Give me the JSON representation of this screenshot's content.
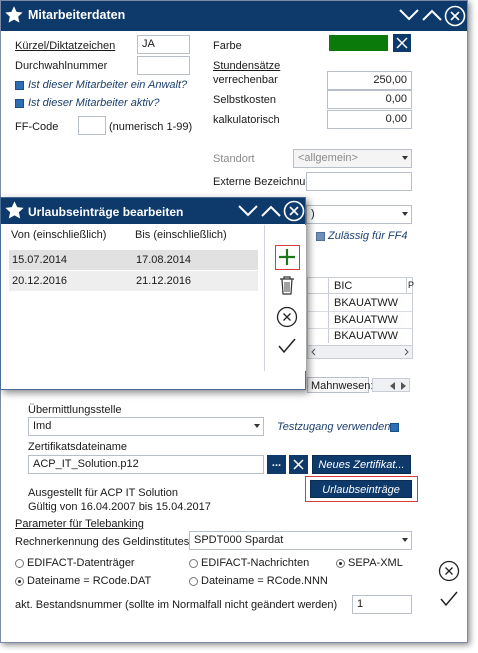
{
  "main": {
    "title": "Mitarbeiterdaten",
    "kuerzel_label": "Kürzel/Diktatzeichen",
    "kuerzel_value": "JA",
    "durchwahl_label": "Durchwahlnummer",
    "anwalt_label": "Ist dieser Mitarbeiter ein Anwalt?",
    "aktiv_label": "Ist dieser Mitarbeiter aktiv?",
    "ffcode_label": "FF-Code",
    "ffcode_hint": "(numerisch 1-99)",
    "farbe_label": "Farbe",
    "farbe_color": "#0a7a0a",
    "stundensaetze_label": "Stundensätze",
    "verrechenbar_label": "verrechenbar",
    "verrechenbar_value": "250,00",
    "selbstkosten_label": "Selbstkosten",
    "selbstkosten_value": "0,00",
    "kalkulatorisch_label": "kalkulatorisch",
    "kalkulatorisch_value": "0,00",
    "standort_label": "Standort",
    "standort_value": "<allgemein>",
    "externe_label": "Externe Bezeichnun",
    "zulaessig_label": "Zulässig für FF4",
    "grid_header": "BIC",
    "grid_header2": "P",
    "grid_rows": [
      "BKAUATWW",
      "BKAUATWW",
      "BKAUATWW"
    ],
    "mahnwesen_tab": "Mahnwesen:",
    "uebermittlung_label": "Übermittlungsstelle",
    "uebermittlung_value": "Imd",
    "testzugang_label": "Testzugang verwenden",
    "zertifikat_label": "Zertifikatsdateiname",
    "zertifikat_value": "ACP_IT_Solution.p12",
    "browse_label": "...",
    "neues_zertifikat_label": "Neues Zertifikat...",
    "urlaubseintraege_label": "Urlaubseinträge",
    "ausgestellt_text": "Ausgestellt für ACP IT Solution",
    "gueltig_text": "Gültig von 16.04.2007 bis 15.04.2017",
    "telebanking_label": "Parameter für Telebanking",
    "rechenkennung_label": "Rechnerkennung des Geldinstitutes",
    "rechenkennung_value": "SPDT000 Spardat",
    "radio_edifact_dt": "EDIFACT-Datenträger",
    "radio_edifact_na": "EDIFACT-Nachrichten",
    "radio_sepa": "SEPA-XML",
    "radio_dat": "Dateiname = RCode.DAT",
    "radio_nnn": "Dateiname = RCode.NNN",
    "bestandsnummer_label": "akt. Bestandsnummer (sollte im Normalfall nicht geändert werden)",
    "bestandsnummer_value": "1",
    "accent_color": "#0e3a6b",
    "highlight_color": "#d93a3a"
  },
  "dialog": {
    "title": "Urlaubseinträge bearbeiten",
    "col_von": "Von (einschließlich)",
    "col_bis": "Bis (einschließlich)",
    "rows": [
      {
        "von": "15.07.2014",
        "bis": "17.08.2014"
      },
      {
        "von": "20.12.2016",
        "bis": "21.12.2016"
      }
    ]
  }
}
